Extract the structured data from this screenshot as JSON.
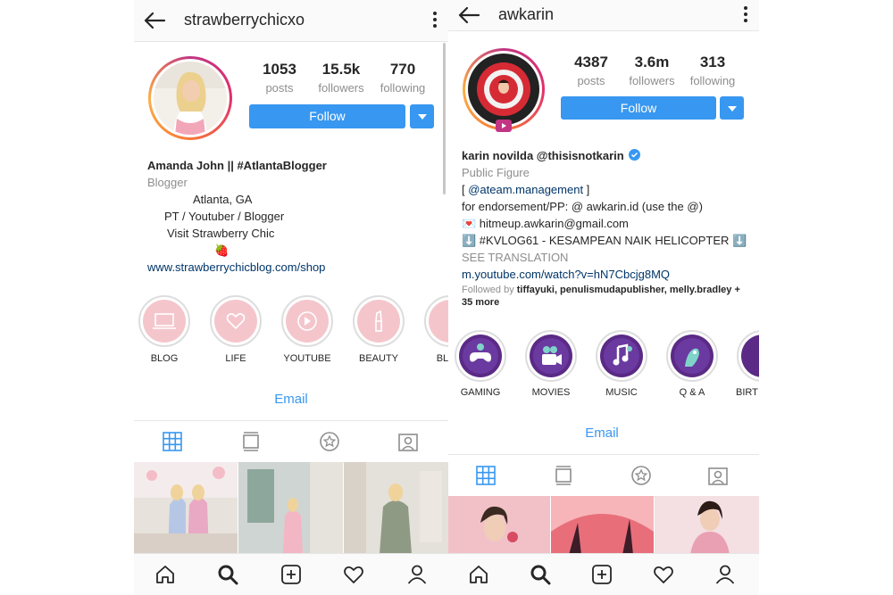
{
  "profile1": {
    "username": "strawberrychicxo",
    "stats": [
      {
        "value": "1053",
        "label": "posts"
      },
      {
        "value": "15.5k",
        "label": "followers"
      },
      {
        "value": "770",
        "label": "following"
      }
    ],
    "follow_label": "Follow",
    "bio": {
      "name": "Amanda John || #AtlantaBlogger",
      "category": "Blogger",
      "lines": [
        "Atlanta, GA",
        "PT / Youtuber / Blogger",
        "Visit Strawberry Chic",
        "🍓"
      ],
      "website": "www.strawberrychicblog.com/shop"
    },
    "highlights": [
      "BLOG",
      "LIFE",
      "YOUTUBE",
      "BEAUTY",
      "BLOG"
    ],
    "email_label": "Email"
  },
  "profile2": {
    "username": "awkarin",
    "stats": [
      {
        "value": "4387",
        "label": "posts"
      },
      {
        "value": "3.6m",
        "label": "followers"
      },
      {
        "value": "313",
        "label": "following"
      }
    ],
    "follow_label": "Follow",
    "bio": {
      "name": "karin novilda @thisisnotkarin",
      "category": "Public Figure",
      "line1_pre": "[ ",
      "line1_link": "@ateam.management",
      "line1_post": " ]",
      "line2": "for endorsement/PP: @ awkarin.id (use the @)",
      "line3": "💌 hitmeup.awkarin@gmail.com",
      "line4": "⬇️ #KVLOG61 - KESAMPEAN NAIK HELICOPTER ⬇️",
      "see_translation": "SEE TRANSLATION",
      "website": "m.youtube.com/watch?v=hN7Cbcjg8MQ",
      "followed_by_prefix": "Followed by",
      "followed_by_names": "tiffayuki, penulismudapublisher, melly.bradley",
      "followed_by_more": "+ 35 more"
    },
    "highlights": [
      "GAMING",
      "MOVIES",
      "MUSIC",
      "Q & A",
      "BIRT"
    ],
    "email_label": "Email"
  },
  "colors": {
    "accent": "#3897f0",
    "link": "#003569",
    "muted": "#8e8e8e",
    "highlight_pink": "#f4c6cc",
    "highlight_purple": "#5b2a86"
  }
}
